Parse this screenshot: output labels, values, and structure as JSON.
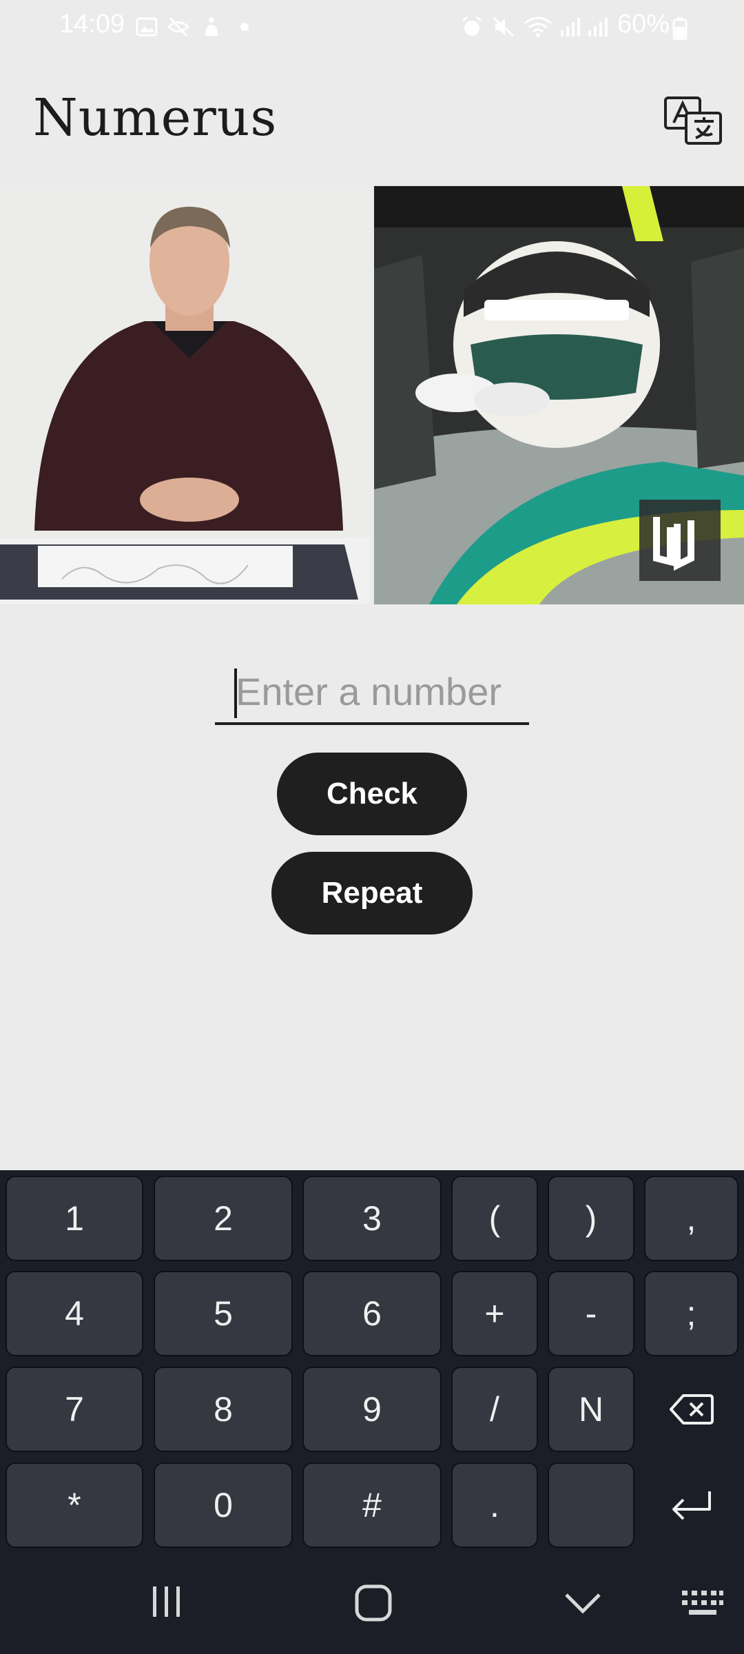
{
  "status_bar": {
    "time": "14:09",
    "battery": "60%",
    "icons_left": [
      "gallery-icon",
      "eye-off-icon",
      "accessibility-icon",
      "dot-icon"
    ],
    "icons_right": [
      "alarm-icon",
      "mute-icon",
      "wifi-icon",
      "signal-icon",
      "signal-icon",
      "battery-icon"
    ]
  },
  "app": {
    "title": "Numerus",
    "translate_icon": "translate-icon"
  },
  "main": {
    "input_placeholder": "Enter a number",
    "check_label": "Check",
    "repeat_label": "Repeat"
  },
  "keyboard": {
    "rows": [
      [
        "1",
        "2",
        "3",
        "(",
        ")",
        ","
      ],
      [
        "4",
        "5",
        "6",
        "+",
        "-",
        ";"
      ],
      [
        "7",
        "8",
        "9",
        "/",
        "N",
        "backspace-icon"
      ],
      [
        "*",
        "0",
        "#",
        ".",
        "",
        "enter-icon"
      ]
    ]
  },
  "navbar": {
    "buttons": [
      "recents-icon",
      "home-icon",
      "back-icon",
      "keyboard-icon"
    ]
  }
}
